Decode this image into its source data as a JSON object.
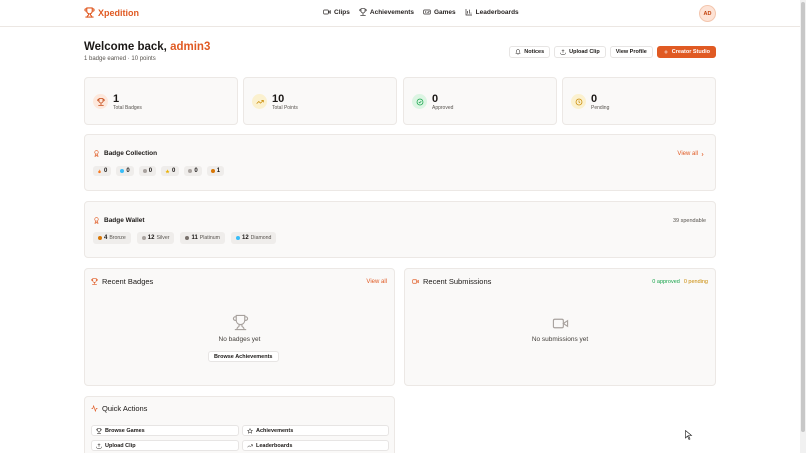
{
  "brand": {
    "name": "Xpedition",
    "accent": "#e05a23"
  },
  "nav": [
    {
      "label": "Clips",
      "icon": "video-icon"
    },
    {
      "label": "Achievements",
      "icon": "trophy-icon"
    },
    {
      "label": "Games",
      "icon": "gamepad-icon"
    },
    {
      "label": "Leaderboards",
      "icon": "bar-chart-icon"
    }
  ],
  "user": {
    "initials": "AD",
    "name": "admin3"
  },
  "welcome": {
    "prefix": "Welcome back,",
    "subtitle": "1 badge earned · 10 points"
  },
  "actions": {
    "notices": "Notices",
    "upload": "Upload Clip",
    "profile": "View Profile",
    "studio": "Creator Studio"
  },
  "stats": [
    {
      "value": "1",
      "label": "Total Badges",
      "icon": "trophy-icon",
      "color": "#c2410c",
      "bg": "#fde8dc"
    },
    {
      "value": "10",
      "label": "Total Points",
      "icon": "trending-up-icon",
      "color": "#ca8a04",
      "bg": "#fbf1cf"
    },
    {
      "value": "0",
      "label": "Approved",
      "icon": "check-circle-icon",
      "color": "#16a34a",
      "bg": "#dcf5e3"
    },
    {
      "value": "0",
      "label": "Pending",
      "icon": "clock-icon",
      "color": "#ca8a04",
      "bg": "#fbf1cf"
    }
  ],
  "badge_collection": {
    "title": "Badge Collection",
    "view_all": "View all",
    "tiers": [
      {
        "count": "0",
        "color": "#f97316",
        "icon": "flame-icon"
      },
      {
        "count": "0",
        "color": "#38bdf8",
        "icon": "diamond-dot-icon"
      },
      {
        "count": "0",
        "color": "#a8a29e",
        "icon": "platinum-dot-icon"
      },
      {
        "count": "0",
        "color": "#eab308",
        "icon": "star-icon"
      },
      {
        "count": "0",
        "color": "#a8a29e",
        "icon": "silver-dot-icon"
      },
      {
        "count": "1",
        "color": "#d97706",
        "icon": "bronze-dot-icon"
      }
    ]
  },
  "badge_wallet": {
    "title": "Badge Wallet",
    "spendable": "39 spendable",
    "items": [
      {
        "count": "4",
        "name": "Bronze",
        "color": "#d97706"
      },
      {
        "count": "12",
        "name": "Silver",
        "color": "#a8a29e"
      },
      {
        "count": "11",
        "name": "Platinum",
        "color": "#78716c"
      },
      {
        "count": "12",
        "name": "Diamond",
        "color": "#38bdf8"
      }
    ]
  },
  "recent_badges": {
    "title": "Recent Badges",
    "view_all": "View all",
    "empty": "No badges yet",
    "browse": "Browse Achievements"
  },
  "recent_submissions": {
    "title": "Recent Submissions",
    "approved": "0 approved",
    "pending": "0 pending",
    "empty": "No submissions yet"
  },
  "quick_actions": {
    "title": "Quick Actions",
    "items": [
      {
        "label": "Browse Games",
        "icon": "trophy-icon"
      },
      {
        "label": "Achievements",
        "icon": "star-icon"
      },
      {
        "label": "Upload Clip",
        "icon": "upload-icon"
      },
      {
        "label": "Leaderboards",
        "icon": "trending-up-icon"
      }
    ]
  }
}
